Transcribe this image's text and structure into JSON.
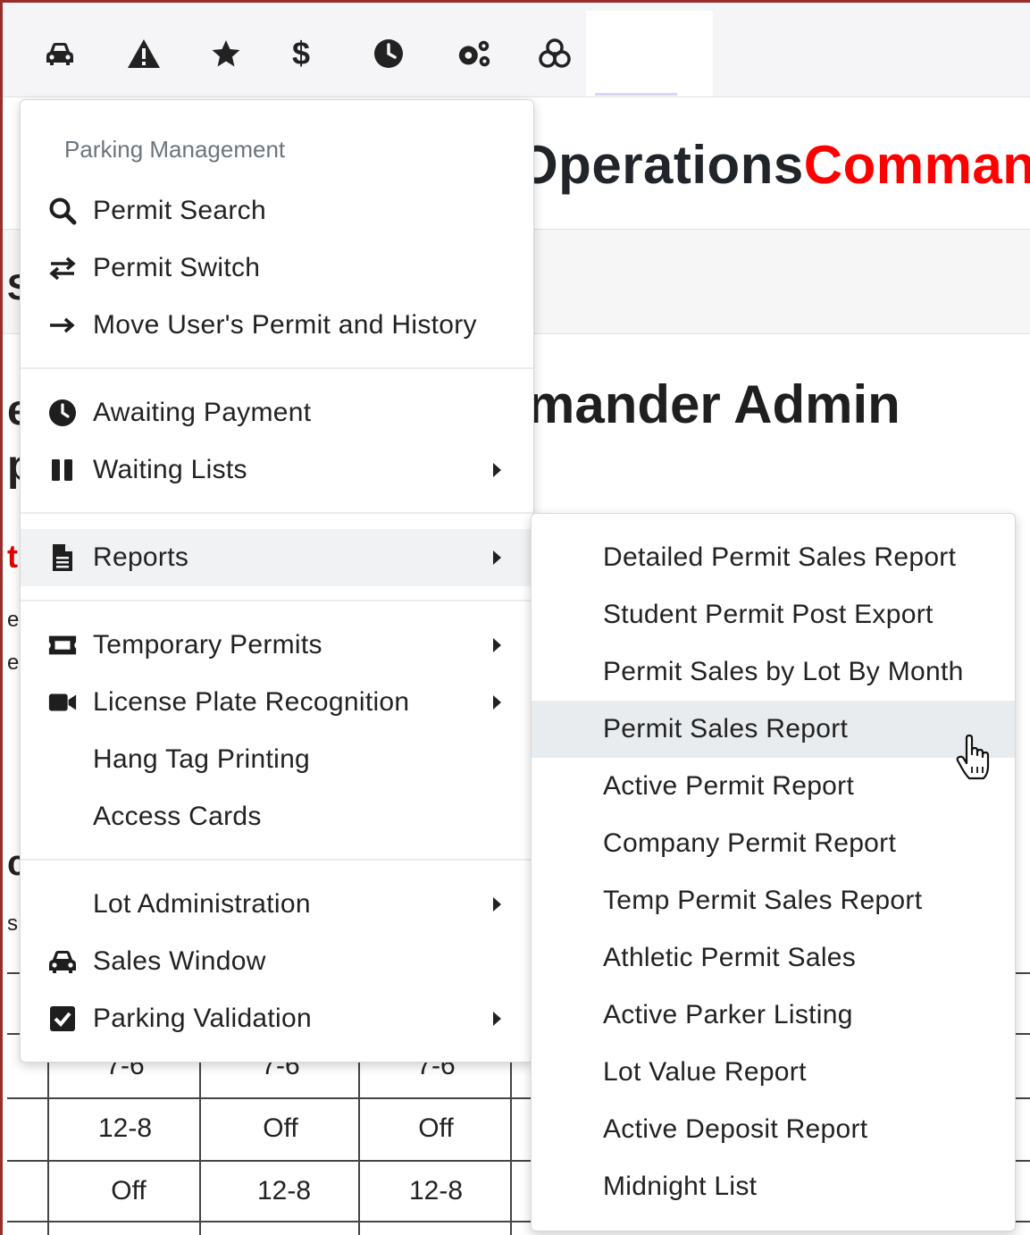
{
  "topbar": {
    "icons": [
      "car-icon",
      "warning-icon",
      "star-icon",
      "dollar-icon",
      "clock-icon",
      "gears-icon",
      "biohazard-icon"
    ]
  },
  "brand": {
    "part1": "Operations",
    "part2": "Comman"
  },
  "background": {
    "title": "mander Admin",
    "fragments": [
      "S",
      "e",
      "p",
      "t",
      "e",
      "e",
      "c",
      "s"
    ],
    "schedule": {
      "rows": [
        [
          "7-6",
          "7-6",
          "7-6"
        ],
        [
          "12-8",
          "Off",
          "Off"
        ],
        [
          "Off",
          "12-8",
          "12-8"
        ]
      ]
    }
  },
  "menu": {
    "header": "Parking Management",
    "groups": [
      [
        {
          "label": "Permit Search",
          "icon": "search-icon",
          "submenu": false
        },
        {
          "label": "Permit Switch",
          "icon": "exchange-icon",
          "submenu": false
        },
        {
          "label": "Move User's Permit and History",
          "icon": "arrow-right-icon",
          "submenu": false
        }
      ],
      [
        {
          "label": "Awaiting Payment",
          "icon": "clock-icon",
          "submenu": false
        },
        {
          "label": "Waiting Lists",
          "icon": "pause-icon",
          "submenu": true
        }
      ],
      [
        {
          "label": "Reports",
          "icon": "file-icon",
          "submenu": true,
          "active": true
        }
      ],
      [
        {
          "label": "Temporary Permits",
          "icon": "ticket-icon",
          "submenu": true
        },
        {
          "label": "License Plate Recognition",
          "icon": "video-camera-icon",
          "submenu": true
        },
        {
          "label": "Hang Tag Printing",
          "icon": "",
          "submenu": false
        },
        {
          "label": "Access Cards",
          "icon": "",
          "submenu": false
        }
      ],
      [
        {
          "label": "Lot Administration",
          "icon": "",
          "submenu": true
        },
        {
          "label": "Sales Window",
          "icon": "car-icon",
          "submenu": false
        },
        {
          "label": "Parking Validation",
          "icon": "checkbox-icon",
          "submenu": true
        }
      ]
    ]
  },
  "reports_submenu": {
    "items": [
      "Detailed Permit Sales Report",
      "Student Permit Post Export",
      "Permit Sales by Lot By Month",
      "Permit Sales Report",
      "Active Permit Report",
      "Company Permit Report",
      "Temp Permit Sales Report",
      "Athletic Permit Sales",
      "Active Parker Listing",
      "Lot Value Report",
      "Active Deposit Report",
      "Midnight List"
    ],
    "hovered": "Permit Sales Report"
  }
}
